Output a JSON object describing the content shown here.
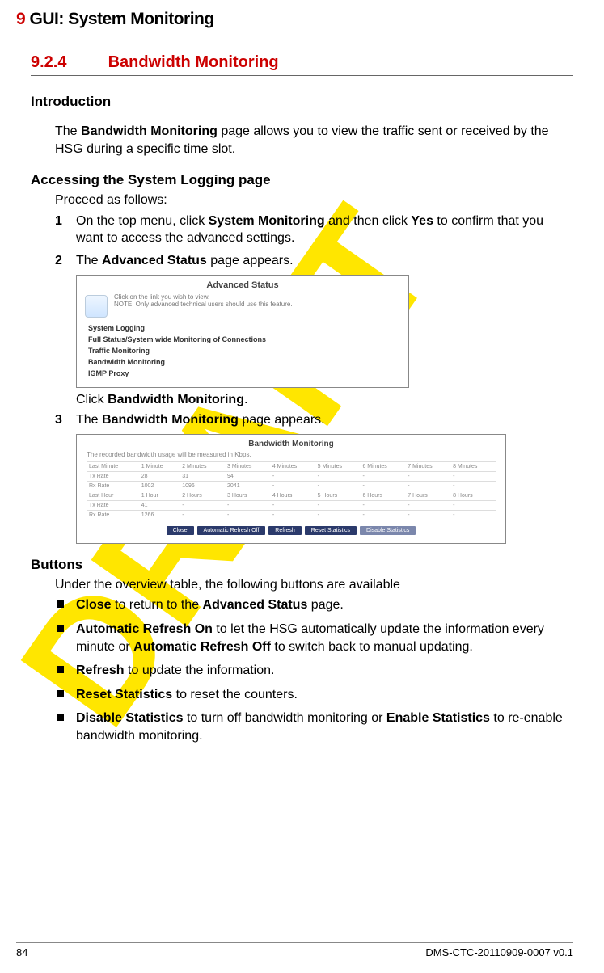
{
  "chapter": {
    "num": "9",
    "title": "GUI: System Monitoring"
  },
  "section": {
    "num": "9.2.4",
    "title": "Bandwidth Monitoring"
  },
  "intro": {
    "heading": "Introduction",
    "p1_a": "The ",
    "p1_b": "Bandwidth Monitoring",
    "p1_c": " page allows you to view the traffic sent or received by the HSG during a specific time slot."
  },
  "access": {
    "heading": "Accessing the System Logging page",
    "lead": "Proceed as follows:",
    "step1_a": "On the top menu, click ",
    "step1_b": "System Monitoring",
    "step1_c": " and then click ",
    "step1_d": "Yes",
    "step1_e": " to confirm that you want to access the advanced settings.",
    "step2_a": "The ",
    "step2_b": "Advanced Status",
    "step2_c": " page appears.",
    "step2_click_a": "Click ",
    "step2_click_b": "Bandwidth Monitoring",
    "step2_click_c": ".",
    "step3_a": "The ",
    "step3_b": "Bandwidth Monitoring",
    "step3_c": " page appears."
  },
  "shot1": {
    "title": "Advanced Status",
    "note1": "Click on the link you wish to view.",
    "note2": "NOTE: Only advanced technical users should use this feature.",
    "links": [
      "System Logging",
      "Full Status/System wide Monitoring of Connections",
      "Traffic Monitoring",
      "Bandwidth Monitoring",
      "IGMP Proxy"
    ]
  },
  "shot2": {
    "title": "Bandwidth Monitoring",
    "sub": "The recorded bandwidth usage will be measured in Kbps.",
    "headers_min": [
      "Last Minute",
      "1 Minute",
      "2 Minutes",
      "3 Minutes",
      "4 Minutes",
      "5 Minutes",
      "6 Minutes",
      "7 Minutes",
      "8 Minutes"
    ],
    "rows": [
      [
        "Tx Rate",
        "28",
        "31",
        "94",
        "-",
        "-",
        "-",
        "-",
        "-"
      ],
      [
        "Rx Rate",
        "1002",
        "1096",
        "2041",
        "-",
        "-",
        "-",
        "-",
        "-"
      ],
      [
        "Last Hour",
        "1 Hour",
        "2 Hours",
        "3 Hours",
        "4 Hours",
        "5 Hours",
        "6 Hours",
        "7 Hours",
        "8 Hours"
      ],
      [
        "Tx Rate",
        "41",
        "-",
        "-",
        "-",
        "-",
        "-",
        "-",
        "-"
      ],
      [
        "Rx Rate",
        "1266",
        "-",
        "-",
        "-",
        "-",
        "-",
        "-",
        "-"
      ]
    ],
    "buttons": [
      "Close",
      "Automatic Refresh Off",
      "Refresh",
      "Reset Statistics",
      "Disable Statistics"
    ]
  },
  "buttons_section": {
    "heading": "Buttons",
    "lead": "Under the overview table, the following buttons are available",
    "items": [
      {
        "b1": "Close",
        "t1": " to return to the ",
        "b2": "Advanced Status",
        "t2": " page."
      },
      {
        "b1": "Automatic Refresh On",
        "t1": " to let the HSG automatically update the information every minute or ",
        "b2": "Automatic Refresh Off",
        "t2": " to switch back to manual updating."
      },
      {
        "b1": "Refresh",
        "t1": " to update the information."
      },
      {
        "b1": "Reset Statistics",
        "t1": " to reset the counters."
      },
      {
        "b1": "Disable Statistics",
        "t1": " to turn off bandwidth monitoring or ",
        "b2": "Enable Statistics",
        "t2": " to re-enable bandwidth monitoring."
      }
    ]
  },
  "footer": {
    "page": "84",
    "doc": "DMS-CTC-20110909-0007 v0.1"
  }
}
